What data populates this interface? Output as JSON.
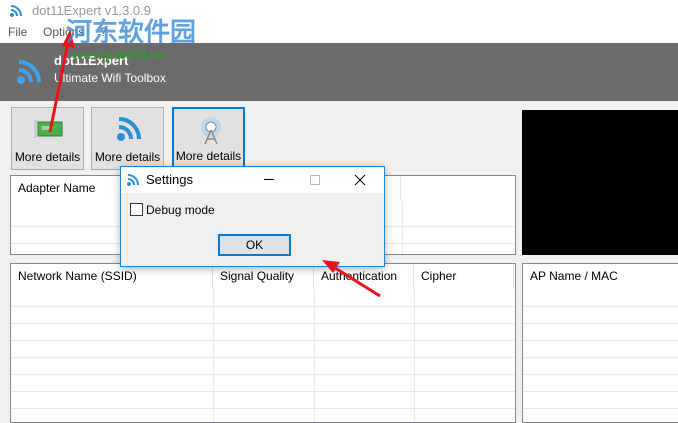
{
  "window": {
    "title": "dot11Expert v1.3.0.9"
  },
  "menu": [
    "File",
    "Options",
    "?"
  ],
  "banner": {
    "name": "dot11Expert",
    "subtitle": "Ultimate Wifi Toolbox"
  },
  "toolbar": [
    {
      "label": "More details",
      "icon": "network-card-icon"
    },
    {
      "label": "More details",
      "icon": "wifi-icon"
    },
    {
      "label": "More details",
      "icon": "antenna-tower-icon"
    }
  ],
  "adapters": {
    "columns": [
      "Adapter Name"
    ]
  },
  "networks": {
    "columns": [
      "Network Name (SSID)",
      "Signal Quality",
      "Authentication",
      "Cipher"
    ]
  },
  "access_points": {
    "columns": [
      "AP Name / MAC"
    ]
  },
  "dialog": {
    "title": "Settings",
    "debug_label": "Debug mode",
    "debug_checked": false,
    "ok": "OK"
  },
  "watermark": {
    "cn": "河东软件园",
    "url": "www.pc0359.cn"
  }
}
